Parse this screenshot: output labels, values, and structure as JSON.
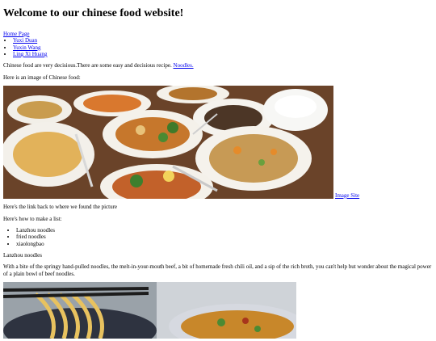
{
  "header": {
    "title": "Welcome to our chinese food website!"
  },
  "nav": {
    "home_link": "Home Page",
    "authors": [
      "Yuxi Duan",
      "Yuxin Wang",
      "Ling Xi Huang"
    ]
  },
  "intro": {
    "text": "Chinese food are very decisious.There are some easy and decisious recipe. ",
    "link": "Noodles."
  },
  "image_intro": "Here is an image of Chinese food:",
  "hero": {
    "link": "Image Site"
  },
  "link_back_text": "Here's the link back to where we found the picture",
  "list_intro": "Here's how to make a list:",
  "foods": [
    "Lanzhou noodles",
    "fried noodles",
    "xiaolongbao"
  ],
  "section_title": "Lanzhou noodles",
  "section_text": "With a bite of the springy hand-pulled noodles, the melt-in-your-mouth beef, a bit of homemade fresh chili oil, and a sip of the rich broth, you can't help but wonder about the magical power of a plain bowl of beef noodles."
}
